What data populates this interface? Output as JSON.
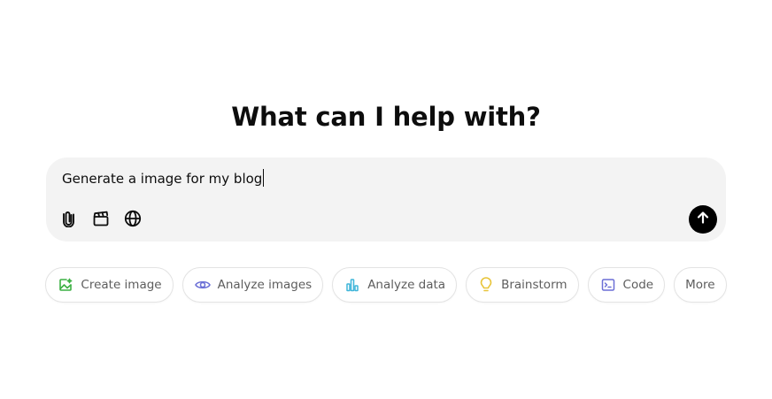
{
  "heading": "What can I help with?",
  "composer": {
    "input_value": "Generate a image for my blog",
    "tools": [
      {
        "icon": "paperclip-icon"
      },
      {
        "icon": "clapperboard-icon"
      },
      {
        "icon": "globe-icon"
      }
    ],
    "send_icon": "arrow-up-icon"
  },
  "chips": [
    {
      "label": "Create image",
      "icon": "image-icon",
      "color": "#3cb043"
    },
    {
      "label": "Analyze images",
      "icon": "eye-icon",
      "color": "#6b6fd6"
    },
    {
      "label": "Analyze data",
      "icon": "bar-chart-icon",
      "color": "#3fb5d9"
    },
    {
      "label": "Brainstorm",
      "icon": "lightbulb-icon",
      "color": "#e8c43a"
    },
    {
      "label": "Code",
      "icon": "terminal-icon",
      "color": "#6b6fd6"
    },
    {
      "label": "More"
    }
  ]
}
